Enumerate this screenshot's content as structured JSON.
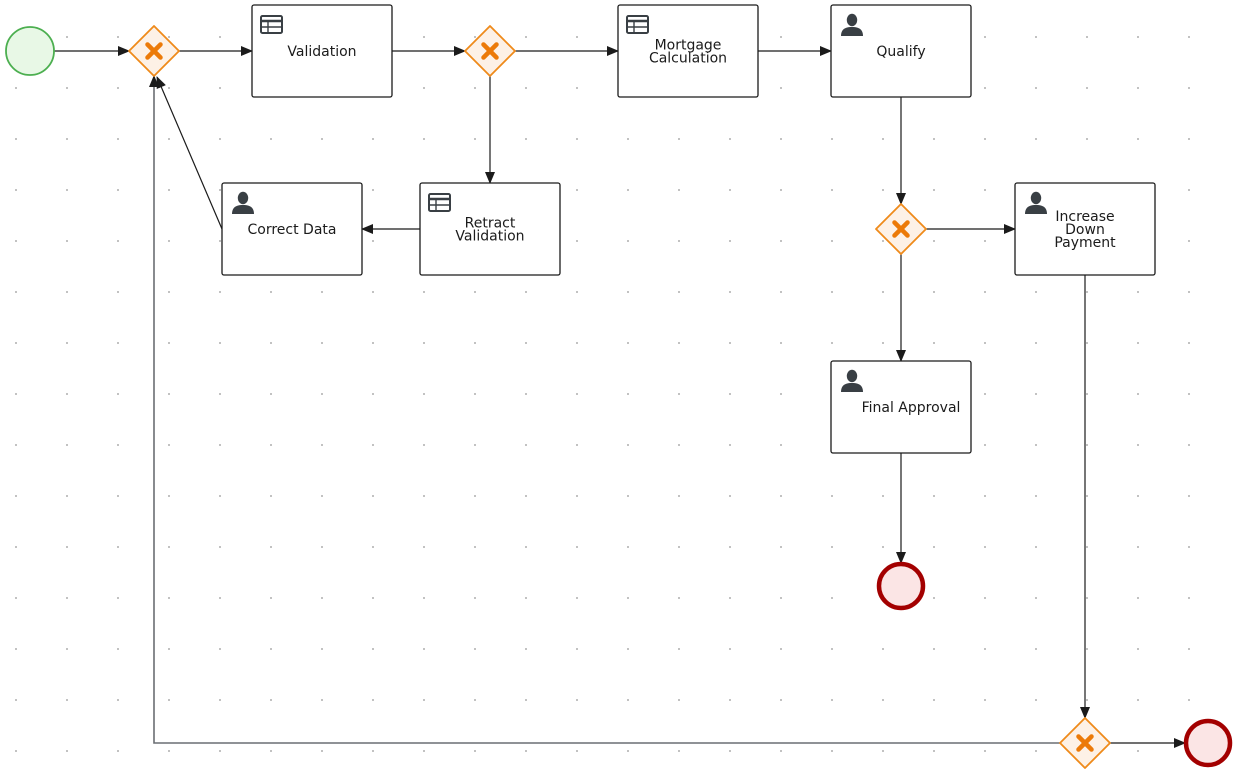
{
  "diagram": {
    "type": "bpmn-process",
    "colors": {
      "start_stroke": "#4caf50",
      "start_fill": "#e8f8e6",
      "end_stroke": "#a30000",
      "end_fill": "#fbe5e5",
      "gateway_stroke": "#ef8a1a",
      "gateway_fill": "#fdf1e6",
      "gateway_mark": "#ec7a08",
      "task_stroke": "#1b1b1b",
      "icon": "#393f44",
      "flow": "#1b1b1b"
    },
    "nodes": [
      {
        "id": "start",
        "kind": "start-event",
        "label": ""
      },
      {
        "id": "gw1",
        "kind": "exclusive-gateway",
        "label": ""
      },
      {
        "id": "validation",
        "kind": "business-rule-task",
        "icon": "table-icon",
        "label_lines": [
          "Validation"
        ]
      },
      {
        "id": "gw2",
        "kind": "exclusive-gateway",
        "label": ""
      },
      {
        "id": "mortgage",
        "kind": "business-rule-task",
        "icon": "table-icon",
        "label_lines": [
          "Mortgage",
          "Calculation"
        ]
      },
      {
        "id": "qualify",
        "kind": "user-task",
        "icon": "user-icon",
        "label_lines": [
          "Qualify"
        ]
      },
      {
        "id": "retract",
        "kind": "business-rule-task",
        "icon": "table-icon",
        "label_lines": [
          "Retract",
          "Validation"
        ]
      },
      {
        "id": "correct",
        "kind": "user-task",
        "icon": "user-icon",
        "label_lines": [
          "Correct Data"
        ]
      },
      {
        "id": "gw3",
        "kind": "exclusive-gateway",
        "label": ""
      },
      {
        "id": "increase",
        "kind": "user-task",
        "icon": "user-icon",
        "label_lines": [
          "Increase",
          "Down",
          "Payment"
        ]
      },
      {
        "id": "final",
        "kind": "user-task",
        "icon": "user-icon",
        "label_lines": [
          "Final Approval"
        ]
      },
      {
        "id": "end1",
        "kind": "end-event",
        "label": ""
      },
      {
        "id": "gw4",
        "kind": "exclusive-gateway",
        "label": ""
      },
      {
        "id": "end2",
        "kind": "end-event",
        "label": ""
      }
    ],
    "flows": [
      {
        "from": "start",
        "to": "gw1"
      },
      {
        "from": "gw1",
        "to": "validation"
      },
      {
        "from": "validation",
        "to": "gw2"
      },
      {
        "from": "gw2",
        "to": "mortgage"
      },
      {
        "from": "gw2",
        "to": "retract"
      },
      {
        "from": "mortgage",
        "to": "qualify"
      },
      {
        "from": "retract",
        "to": "correct"
      },
      {
        "from": "correct",
        "to": "gw1"
      },
      {
        "from": "qualify",
        "to": "gw3"
      },
      {
        "from": "gw3",
        "to": "increase"
      },
      {
        "from": "gw3",
        "to": "final"
      },
      {
        "from": "final",
        "to": "end1"
      },
      {
        "from": "increase",
        "to": "gw4"
      },
      {
        "from": "gw4",
        "to": "end2"
      },
      {
        "from": "gw4",
        "to": "gw1"
      }
    ]
  }
}
